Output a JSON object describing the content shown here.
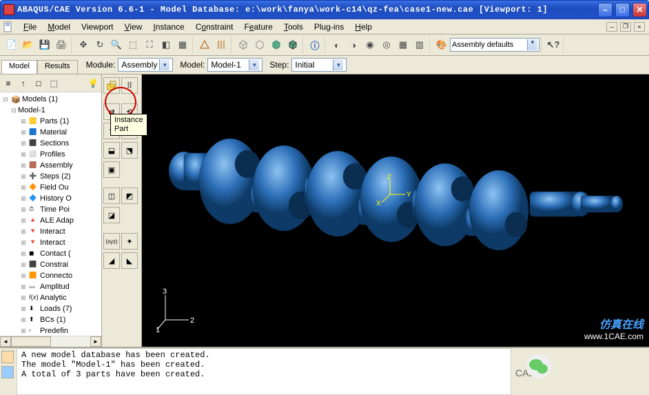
{
  "titlebar": {
    "title": "ABAQUS/CAE Version 6.6-1 - Model Database: e:\\work\\fanya\\work-c14\\qz-fea\\case1-new.cae [Viewport: 1]"
  },
  "menu": {
    "file": "File",
    "model": "Model",
    "viewport": "Viewport",
    "view": "View",
    "instance": "Instance",
    "constraint": "Constraint",
    "feature": "Feature",
    "tools": "Tools",
    "plugins": "Plug-ins",
    "help": "Help"
  },
  "context": {
    "module_label": "Module:",
    "module_value": "Assembly",
    "model_label": "Model:",
    "model_value": "Model-1",
    "step_label": "Step:",
    "step_value": "Initial"
  },
  "tabs": {
    "model": "Model",
    "results": "Results"
  },
  "tree": {
    "root": "Models (1)",
    "model": "Model-1",
    "items": [
      "Parts (1)",
      "Material",
      "Sections",
      "Profiles",
      "Assembly",
      "Steps (2)",
      "Field Ou",
      "History O",
      "Time Poi",
      "ALE Adap",
      "Interact",
      "Interact",
      "Contact (",
      "Constrai",
      "Connecto",
      "Amplitud",
      "Analytic",
      "Loads (7)",
      "BCs (1)",
      "Predefin"
    ]
  },
  "tooltip": "Instance\nPart",
  "toolbar_right_combo": "Assembly defaults",
  "axis": {
    "a1": "1",
    "a2": "2",
    "a3": "3"
  },
  "yaxis": {
    "x": "X",
    "y": "Y",
    "z": "Z"
  },
  "messages": "A new model database has been created.\nThe model \"Model-1\" has been created.\nA total of 3 parts have been created.",
  "watermark": {
    "brand": "仿真在线",
    "site": "www.1CAE.com",
    "left": "CAE技"
  }
}
